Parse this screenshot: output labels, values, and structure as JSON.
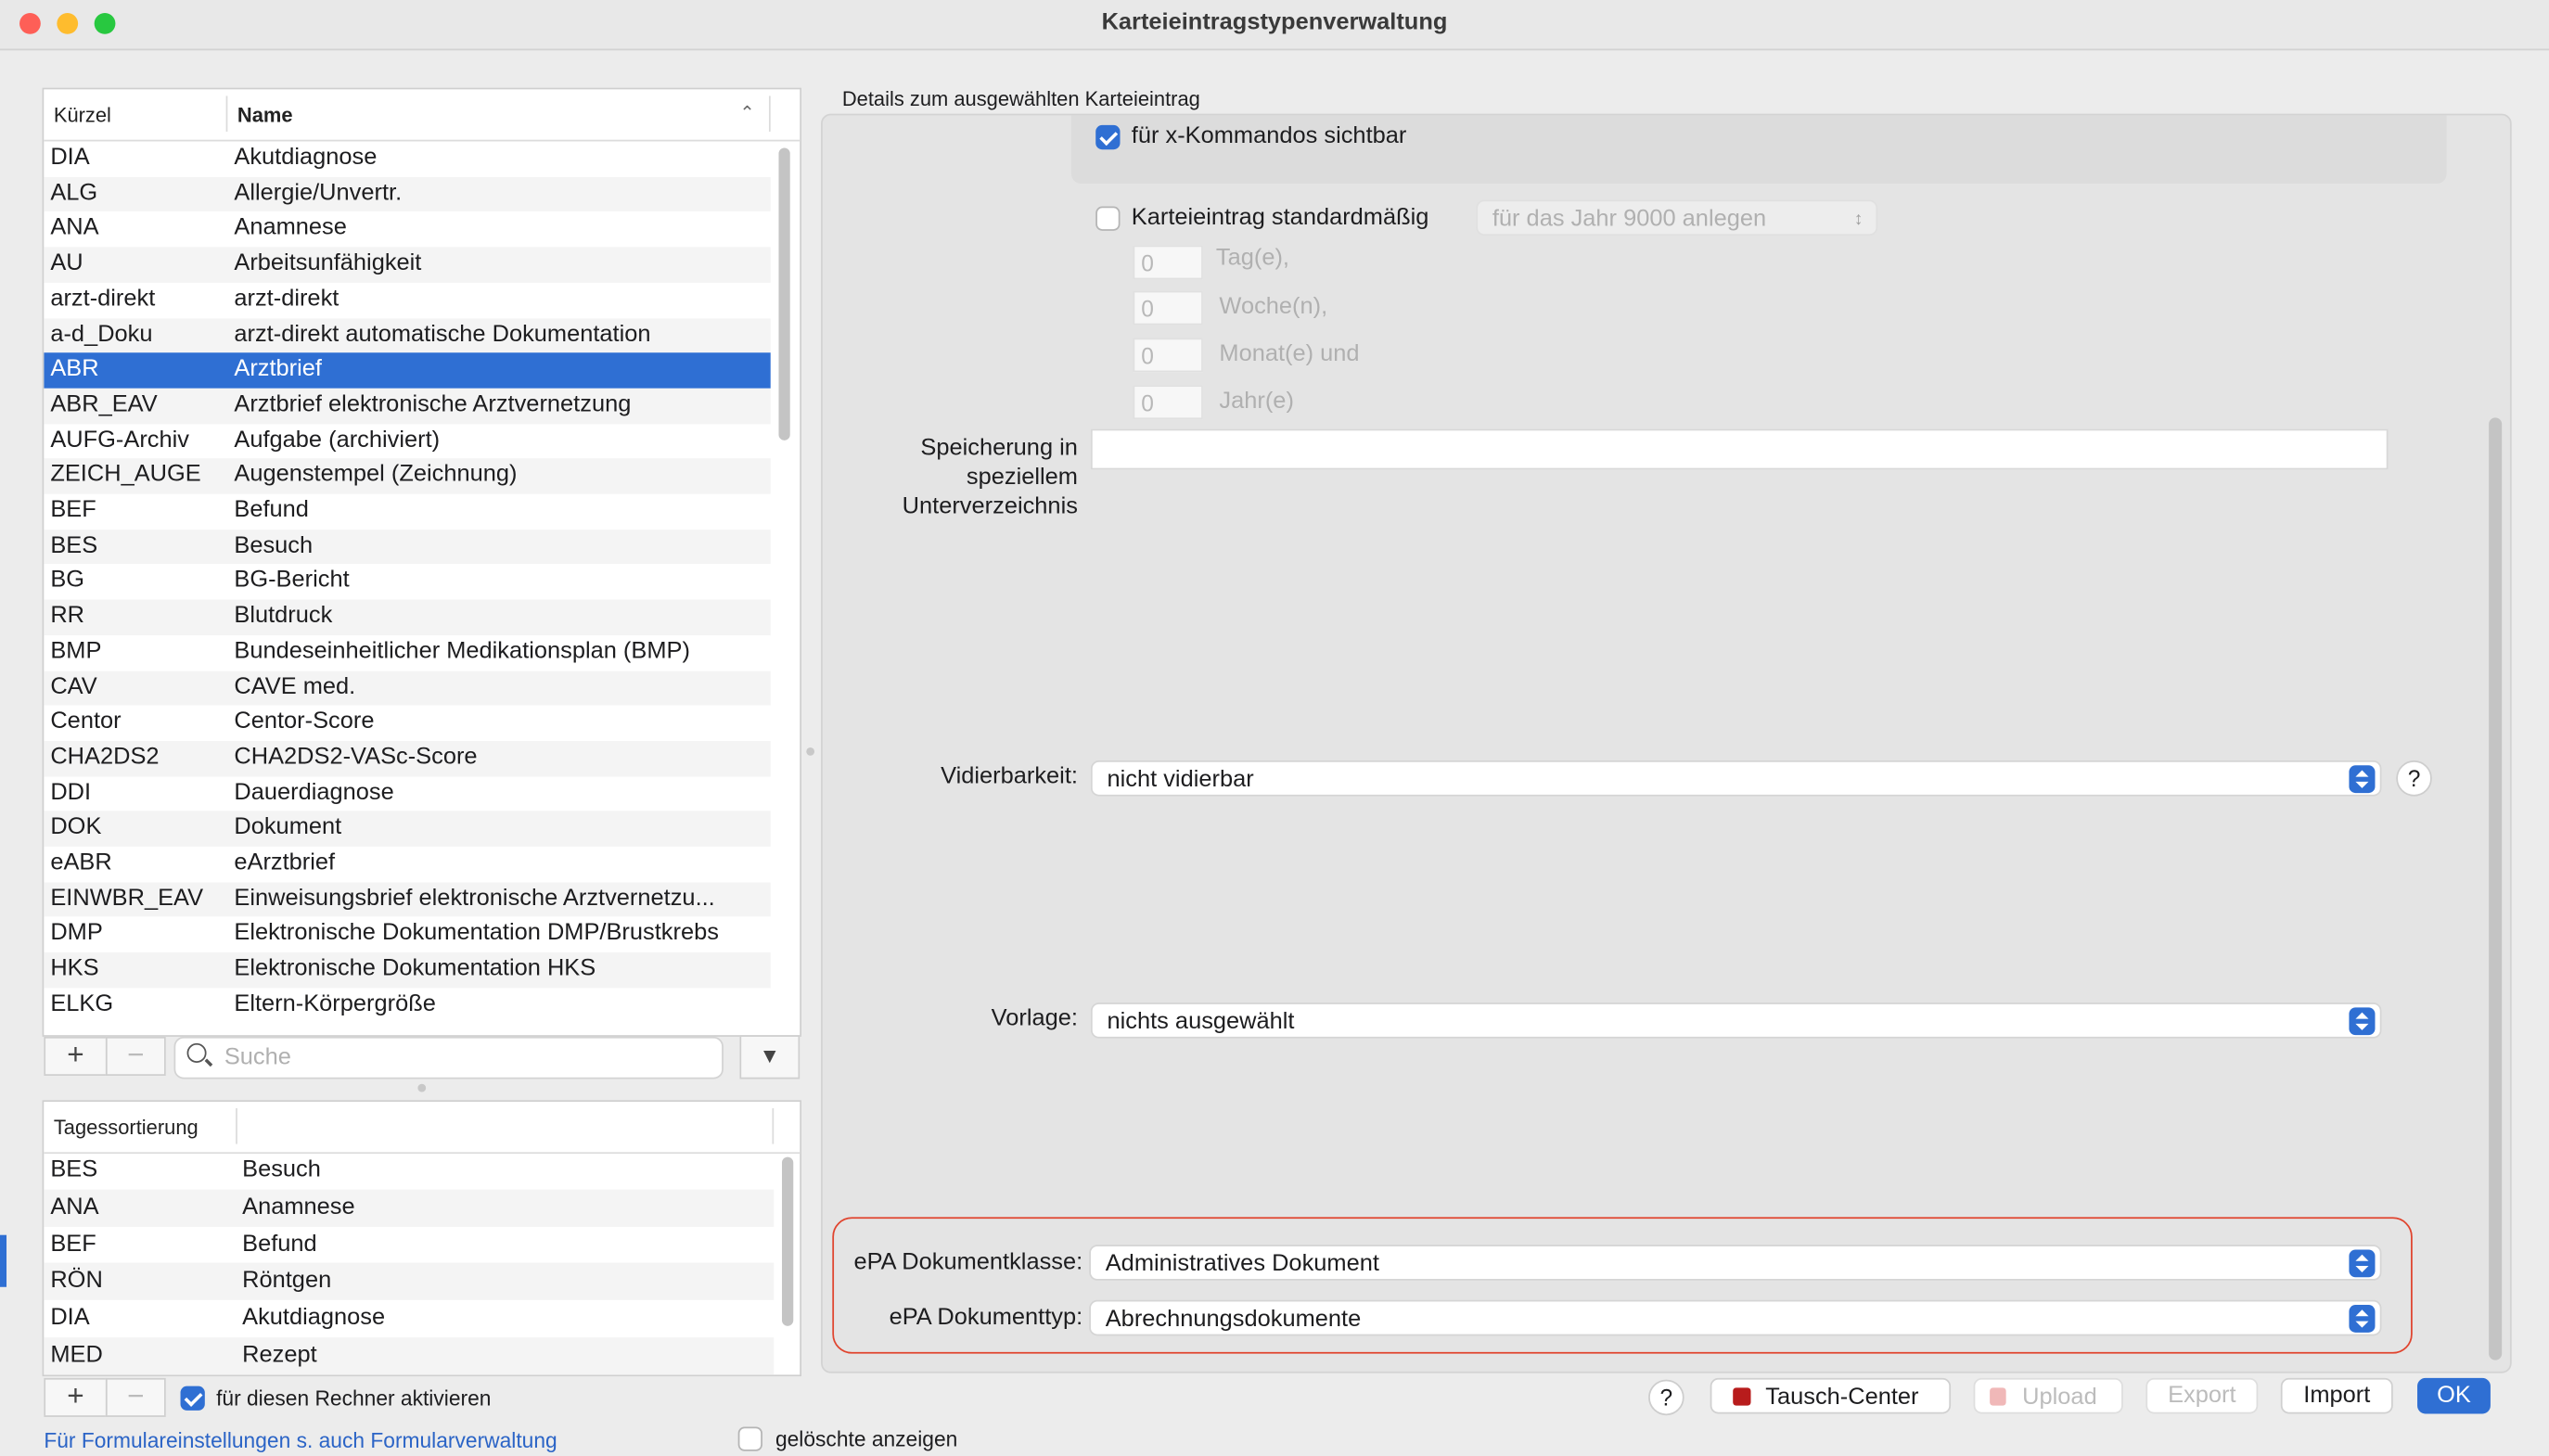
{
  "window": {
    "title": "Karteieintragstypenverwaltung"
  },
  "list": {
    "header_short": "Kürzel",
    "header_name": "Name",
    "rows": [
      {
        "short": "DIA",
        "name": "Akutdiagnose"
      },
      {
        "short": "ALG",
        "name": "Allergie/Unvertr."
      },
      {
        "short": "ANA",
        "name": "Anamnese"
      },
      {
        "short": "AU",
        "name": "Arbeitsunfähigkeit"
      },
      {
        "short": "arzt-direkt",
        "name": "arzt-direkt"
      },
      {
        "short": "a-d_Doku",
        "name": "arzt-direkt automatische Dokumentation"
      },
      {
        "short": "ABR",
        "name": "Arztbrief"
      },
      {
        "short": "ABR_EAV",
        "name": "Arztbrief elektronische Arztvernetzung"
      },
      {
        "short": "AUFG-Archiv",
        "name": "Aufgabe (archiviert)"
      },
      {
        "short": "ZEICH_AUGE",
        "name": "Augenstempel (Zeichnung)"
      },
      {
        "short": "BEF",
        "name": "Befund"
      },
      {
        "short": "BES",
        "name": "Besuch"
      },
      {
        "short": "BG",
        "name": "BG-Bericht"
      },
      {
        "short": "RR",
        "name": "Blutdruck"
      },
      {
        "short": "BMP",
        "name": "Bundeseinheitlicher Medikationsplan (BMP)"
      },
      {
        "short": "CAV",
        "name": "CAVE med."
      },
      {
        "short": "Centor",
        "name": "Centor-Score"
      },
      {
        "short": "CHA2DS2",
        "name": "CHA2DS2-VASc-Score"
      },
      {
        "short": "DDI",
        "name": "Dauerdiagnose"
      },
      {
        "short": "DOK",
        "name": "Dokument"
      },
      {
        "short": "eABR",
        "name": "eArztbrief"
      },
      {
        "short": "EINWBR_EAV",
        "name": "Einweisungsbrief elektronische Arztvernetzu..."
      },
      {
        "short": "DMP",
        "name": "Elektronische Dokumentation DMP/Brustkrebs"
      },
      {
        "short": "HKS",
        "name": "Elektronische Dokumentation HKS"
      },
      {
        "short": "ELKG",
        "name": "Eltern-Körpergröße"
      }
    ],
    "selected_short": "ABR",
    "search_placeholder": "Suche"
  },
  "day_sort": {
    "header": "Tagessortierung",
    "rows": [
      {
        "short": "BES",
        "name": "Besuch"
      },
      {
        "short": "ANA",
        "name": "Anamnese"
      },
      {
        "short": "BEF",
        "name": "Befund"
      },
      {
        "short": "RÖN",
        "name": "Röntgen"
      },
      {
        "short": "DIA",
        "name": "Akutdiagnose"
      },
      {
        "short": "MED",
        "name": "Rezept"
      }
    ],
    "activate_label": "für diesen Rechner aktivieren",
    "activate_checked": true,
    "form_link": "Für Formulareinstellungen s. auch Formularverwaltung",
    "show_deleted_label": "gelöschte anzeigen",
    "show_deleted_checked": false
  },
  "details": {
    "group_label": "Details zum ausgewählten Karteieintrag",
    "x_commands_label": "für x-Kommandos sichtbar",
    "x_commands_checked": true,
    "default_entry_label": "Karteieintrag standardmäßig",
    "default_entry_checked": false,
    "year_popup": "für das Jahr 9000 anlegen",
    "days_value": "0",
    "days_label": "Tag(e),",
    "weeks_value": "0",
    "weeks_label": "Woche(n),",
    "months_value": "0",
    "months_label": "Monat(e) und",
    "years_value": "0",
    "years_label": "Jahr(e)",
    "subdir_label_1": "Speicherung in",
    "subdir_label_2": "speziellem",
    "subdir_label_3": "Unterverzeichnis",
    "subdir_value": "",
    "vidier_label": "Vidierbarkeit:",
    "vidier_value": "nicht vidierbar",
    "template_label": "Vorlage:",
    "template_value": "nichts ausgewählt",
    "epa_class_label": "ePA Dokumentklasse:",
    "epa_class_value": "Administratives Dokument",
    "epa_type_label": "ePA Dokumenttyp:",
    "epa_type_value": "Abrechnungsdokumente"
  },
  "footer": {
    "help": "?",
    "exchange_center": "Tausch-Center",
    "upload": "Upload",
    "export": "Export",
    "import": "Import",
    "ok": "OK"
  },
  "colors": {
    "accent": "#2f6fd3",
    "highlight_border": "#e0442e",
    "close": "#fe5f57",
    "minimize": "#febc2e",
    "maximize": "#28c840"
  }
}
